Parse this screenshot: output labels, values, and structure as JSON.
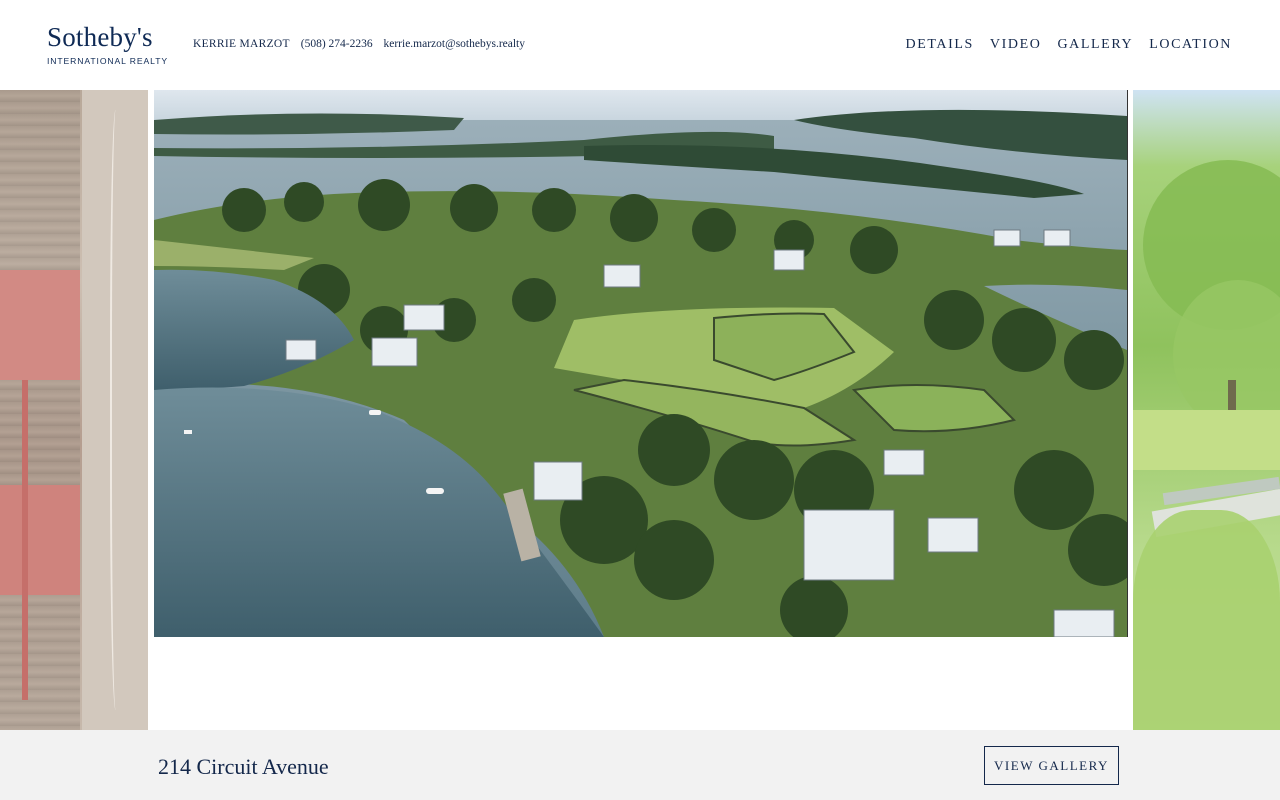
{
  "brand": {
    "name": "Sotheby's",
    "subtitle": "INTERNATIONAL REALTY",
    "color": "#0f2a55"
  },
  "agent": {
    "name": "KERRIE MARZOT",
    "phone": "(508) 274-2236",
    "email": "kerrie.marzot@sothebys.realty"
  },
  "nav": {
    "items": [
      {
        "label": "DETAILS"
      },
      {
        "label": "VIDEO"
      },
      {
        "label": "GALLERY"
      },
      {
        "label": "LOCATION"
      }
    ]
  },
  "carousel": {
    "main_image": "aerial-coastal-neighborhood-photo",
    "left_image": "dock-chairs-photo",
    "right_image": "trees-yard-photo"
  },
  "listing": {
    "address": "214 Circuit Avenue",
    "view_gallery_label": "VIEW GALLERY"
  }
}
